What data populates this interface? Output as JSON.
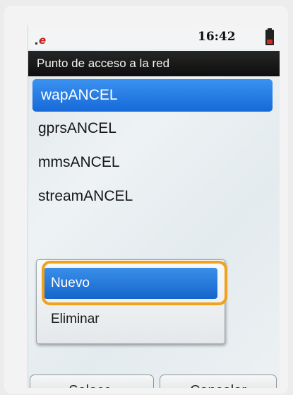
{
  "status": {
    "signal_icon": "signal-e-icon",
    "time": "16:42",
    "battery_icon": "battery-icon"
  },
  "title": "Punto de acceso a la red",
  "list": {
    "items": [
      {
        "label": "wapANCEL",
        "selected": true
      },
      {
        "label": "gprsANCEL",
        "selected": false
      },
      {
        "label": "mmsANCEL",
        "selected": false
      },
      {
        "label": "streamANCEL",
        "selected": false
      }
    ]
  },
  "popup": {
    "items": [
      {
        "label": "Nuevo",
        "selected": true
      },
      {
        "label": "Eliminar",
        "selected": false
      }
    ]
  },
  "softkeys": {
    "left": "Selecc.",
    "right": "Cancelar"
  },
  "colors": {
    "selection": "#1f74de",
    "highlight_outline": "#f0a21c",
    "titlebar": "#1a1a1a"
  }
}
